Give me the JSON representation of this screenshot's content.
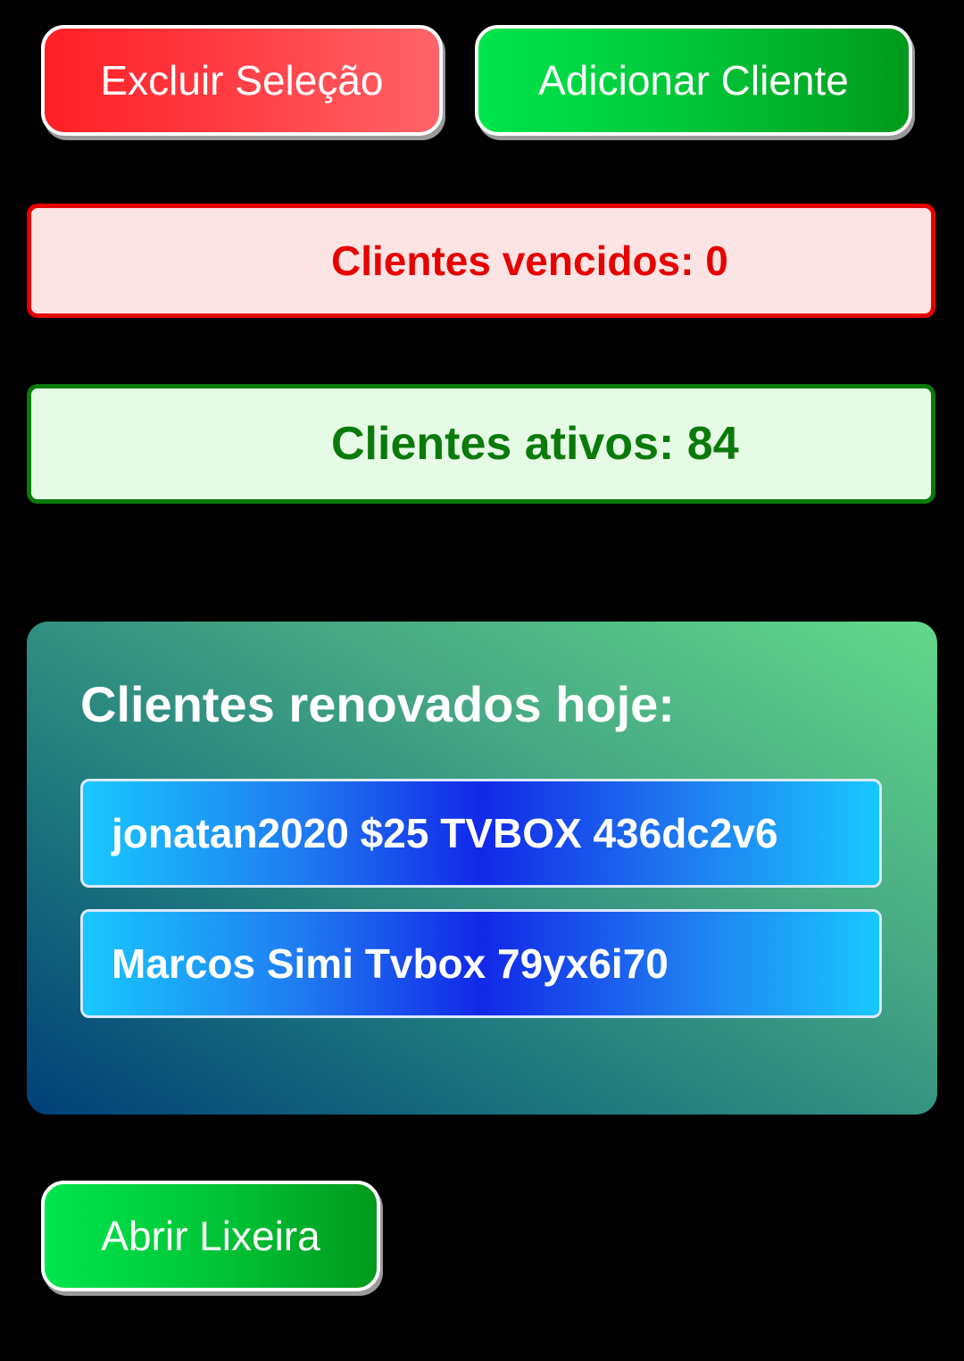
{
  "actions": {
    "delete_selection_label": "Excluir Seleção",
    "add_client_label": "Adicionar Cliente",
    "open_trash_label": "Abrir Lixeira"
  },
  "stats": {
    "overdue_label": "Clientes vencidos: 0",
    "active_label": "Clientes ativos: 84"
  },
  "renewed_today": {
    "title": "Clientes renovados hoje:",
    "items": [
      {
        "label": "jonatan2020 $25 TVBOX 436dc2v6"
      },
      {
        "label": "Marcos Simi Tvbox 79yx6i70"
      }
    ]
  },
  "colors": {
    "background": "#000000",
    "danger": "#e60000",
    "success": "#0a7a0a",
    "accent_blue": "#1228e8"
  }
}
